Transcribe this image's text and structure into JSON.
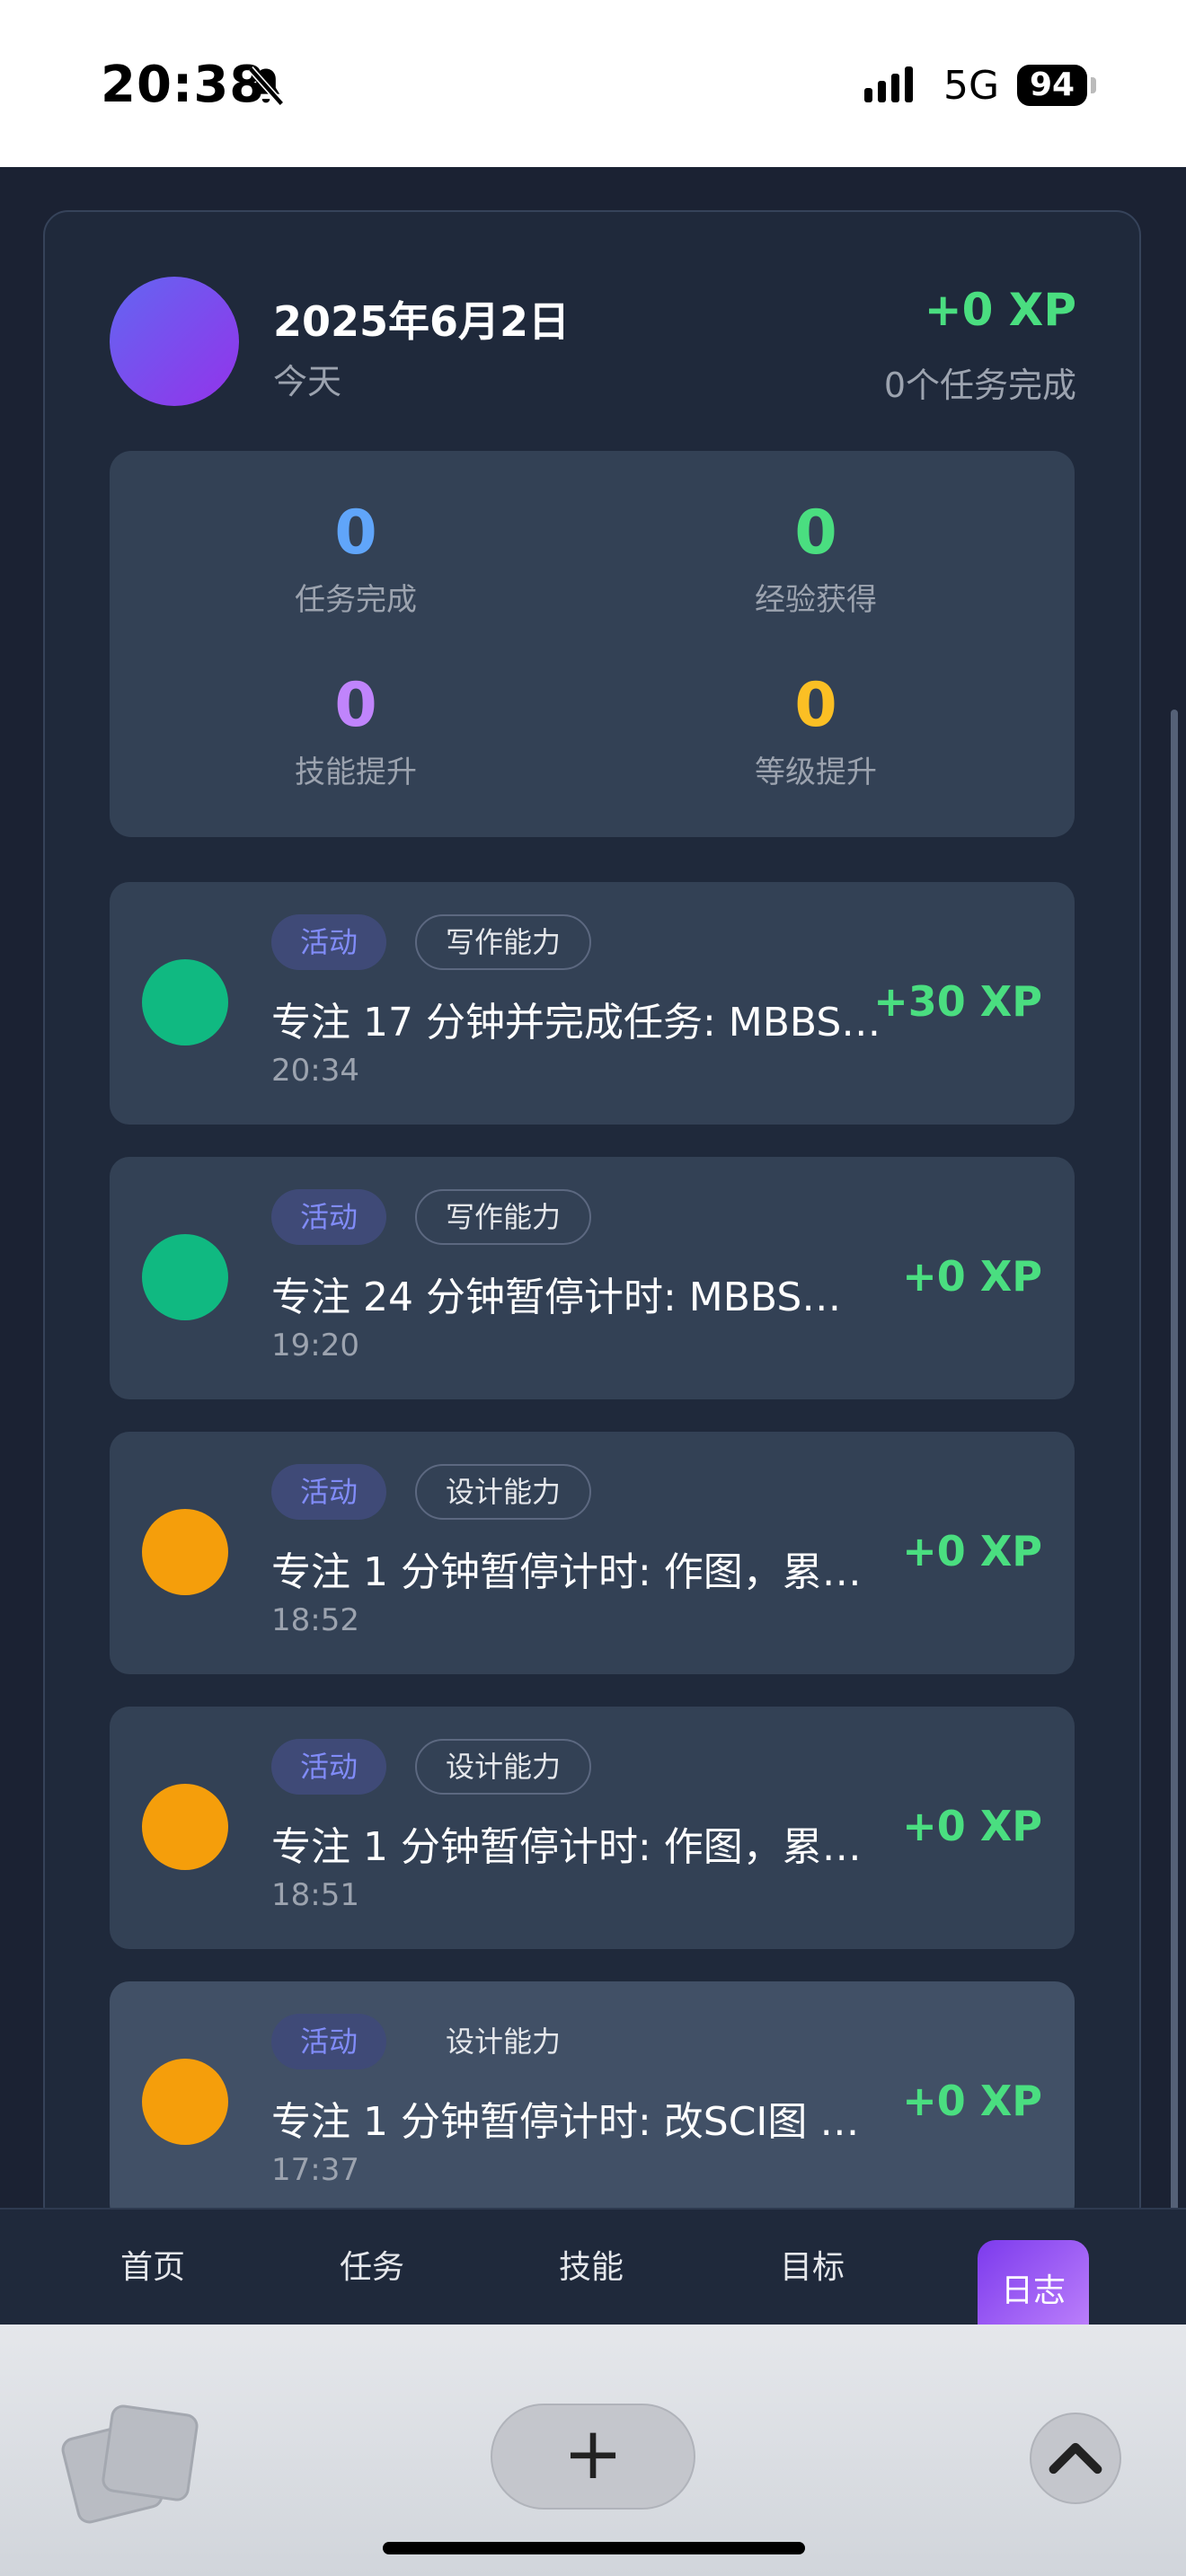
{
  "status_bar": {
    "time": "20:38",
    "network": "5G",
    "battery": "94"
  },
  "day": {
    "date": "2025年6月2日",
    "relative": "今天",
    "xp": "+0 XP",
    "done": "0个任务完成"
  },
  "stats": [
    {
      "value": "0",
      "label": "任务完成",
      "color": "#60a5fa"
    },
    {
      "value": "0",
      "label": "经验获得",
      "color": "#4ade80"
    },
    {
      "value": "0",
      "label": "技能提升",
      "color": "#c084fc"
    },
    {
      "value": "0",
      "label": "等级提升",
      "color": "#fbbf24"
    }
  ],
  "entries": [
    {
      "type": "活动",
      "skill": "写作能力",
      "title": "专注 17 分钟并完成任务: MBBS…",
      "time": "20:34",
      "xp": "+30 XP",
      "color": "#10b981"
    },
    {
      "type": "活动",
      "skill": "写作能力",
      "title": "专注 24 分钟暂停计时: MBBS…",
      "time": "19:20",
      "xp": "+0 XP",
      "color": "#10b981"
    },
    {
      "type": "活动",
      "skill": "设计能力",
      "title": "专注 1 分钟暂停计时: 作图，累…",
      "time": "18:52",
      "xp": "+0 XP",
      "color": "#f59e0b"
    },
    {
      "type": "活动",
      "skill": "设计能力",
      "title": "专注 1 分钟暂停计时: 作图，累…",
      "time": "18:51",
      "xp": "+0 XP",
      "color": "#f59e0b"
    },
    {
      "type": "活动",
      "skill": "设计能力",
      "title": "专注 1 分钟暂停计时: 改SCI图 …",
      "time": "17:37",
      "xp": "+0 XP",
      "color": "#f59e0b"
    }
  ],
  "nav": {
    "home": "首页",
    "tasks": "任务",
    "skills": "技能",
    "goals": "目标",
    "log": "日志"
  },
  "browser": {
    "plus": "+"
  }
}
